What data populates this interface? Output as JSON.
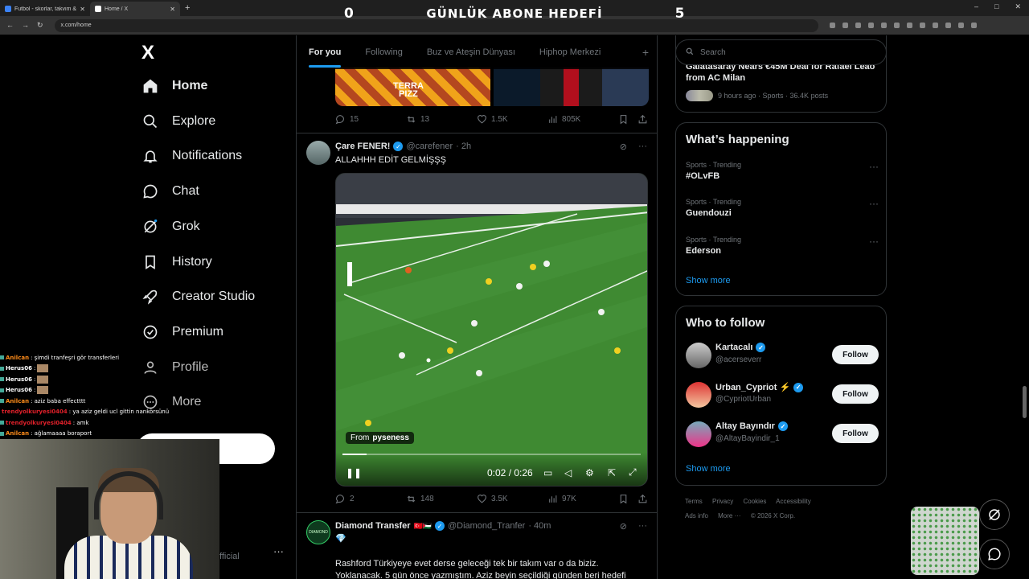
{
  "browser": {
    "tabs": [
      {
        "title": "Futbol - skorlar, takvim & oran"
      },
      {
        "title": "Home / X"
      }
    ],
    "new_tab": "+",
    "url": "x.com/home",
    "window_controls": [
      "–",
      "□",
      "✕"
    ]
  },
  "stream_overlay": {
    "left_count": "0",
    "title": "GÜNLÜK ABONE HEDEFİ",
    "right_count": "5"
  },
  "nav": {
    "logo": "X",
    "items": [
      {
        "label": "Home",
        "icon": "home-icon"
      },
      {
        "label": "Explore",
        "icon": "search-icon"
      },
      {
        "label": "Notifications",
        "icon": "bell-icon"
      },
      {
        "label": "Chat",
        "icon": "chat-icon"
      },
      {
        "label": "Grok",
        "icon": "grok-icon"
      },
      {
        "label": "History",
        "icon": "bookmark-icon"
      },
      {
        "label": "Creator Studio",
        "icon": "rocket-icon"
      },
      {
        "label": "Premium",
        "icon": "verified-icon"
      },
      {
        "label": "Profile",
        "icon": "user-icon"
      },
      {
        "label": "More",
        "icon": "more-icon"
      }
    ],
    "account_suffix": "fficial",
    "account_more": "···"
  },
  "feed": {
    "tabs": [
      "For you",
      "Following",
      "Buz ve Ateşin Dünyası",
      "Hiphop Merkezi"
    ],
    "add_tab": "+",
    "top_post": {
      "image_text": "TERRA\nPIZZ",
      "replies": "15",
      "reposts": "13",
      "likes": "1.5K",
      "views": "805K"
    },
    "post1": {
      "name": "Çare FENER!",
      "handle": "@carefener",
      "time": "· 2h",
      "text": "ALLAHHH EDİT GELMİŞŞŞ",
      "video": {
        "from_label": "From",
        "from_user": "pyseness",
        "time": "0:02 / 0:26",
        "progress": 0.08
      },
      "replies": "2",
      "reposts": "148",
      "likes": "3.5K",
      "views": "97K"
    },
    "post2": {
      "name": "Diamond Transfer",
      "flags": "🇹🇷🇵🇸",
      "handle": "@Diamond_Tranfer",
      "time": "· 40m",
      "avatar_text": "DIAMOND",
      "emoji": "💎",
      "text1": "Rashford Türkiyeye evet derse geleceği tek bir takım var o da biziz.",
      "text2": "Yoklanacak. 5 gün önce yazmıştım. Aziz beyin seçildiği günden beri hedefi"
    }
  },
  "right": {
    "search_placeholder": "Search",
    "news": {
      "title": "Galatasaray Nears €45M Deal for Rafael Leão from AC Milan",
      "meta": "9 hours ago · Sports · 36.4K posts"
    },
    "whats_happening": {
      "title": "What’s happening",
      "trends": [
        {
          "meta": "Sports · Trending",
          "name": "#OLvFB"
        },
        {
          "meta": "Sports · Trending",
          "name": "Guendouzi"
        },
        {
          "meta": "Sports · Trending",
          "name": "Ederson"
        }
      ],
      "show_more": "Show more"
    },
    "who_to_follow": {
      "title": "Who to follow",
      "accounts": [
        {
          "name": "Kartacalı",
          "handle": "@acerseverr",
          "button": "Follow"
        },
        {
          "name": "Urban_Cypriot ⚡",
          "handle": "@CypriotUrban",
          "button": "Follow"
        },
        {
          "name": "Altay Bayındır",
          "handle": "@AltayBayindir_1",
          "button": "Follow"
        }
      ],
      "show_more": "Show more"
    },
    "footer": {
      "links1": [
        "Terms",
        "Privacy",
        "Cookies",
        "Accessibility"
      ],
      "links2": [
        "Ads info",
        "More ···",
        "© 2026 X Corp."
      ]
    }
  },
  "chat_overlay": [
    {
      "user": "Anilcan",
      "color": "#ff8c1a",
      "text": ": şimdi tranfeşri gör transferleri"
    },
    {
      "user": "Herus06",
      "color": "#ffffff",
      "text": ":",
      "emote": true
    },
    {
      "user": "Herus06",
      "color": "#ffffff",
      "text": ":",
      "emote": true
    },
    {
      "user": "Herus06",
      "color": "#ffffff",
      "text": ":",
      "emote": true
    },
    {
      "user": "Anilcan",
      "color": "#ff8c1a",
      "text": ": aziz baba effectttt"
    },
    {
      "user": "trendyolkuryesi0404",
      "color": "#e0202a",
      "text": ": ya aziz geldi ucl gittin nankörsünü"
    },
    {
      "user": "trendyolkuryesi0404",
      "color": "#e0202a",
      "text": ": amk"
    },
    {
      "user": "Anilcan",
      "color": "#ff8c1a",
      "text": ": ağlamaaaa boraport"
    }
  ],
  "colors": {
    "accent": "#1d9bf0",
    "background": "#000000",
    "border": "#2f3336",
    "muted": "#71767b"
  }
}
